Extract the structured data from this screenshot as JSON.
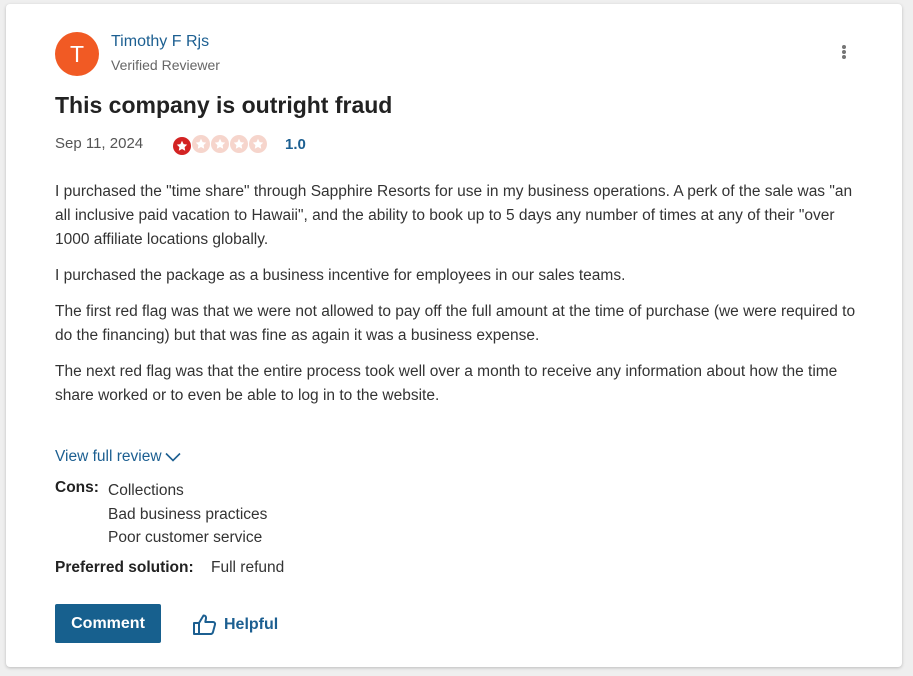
{
  "review": {
    "author": {
      "initial": "T",
      "name": "Timothy F Rjs",
      "status": "Verified Reviewer",
      "avatar_color": "#f15a24"
    },
    "more_icon": "more-vertical-icon",
    "title": "This company is outright fraud",
    "date": "Sep 11, 2024",
    "rating": {
      "value": 1.0,
      "max": 5,
      "label": "1.0",
      "filled_color": "#d32323",
      "empty_color": "#f6d5cc"
    },
    "paragraphs": [
      "I purchased the \"time share\" through Sapphire Resorts for use in my business operations. A perk of the sale was \"an all inclusive paid vacation to Hawaii\", and the ability to book up to 5 days any number of times at any of their \"over 1000 affiliate locations globally.",
      "I purchased the package as a business incentive for employees in our sales teams.",
      "The first red flag was that we were not allowed to pay off the full amount at the time of purchase (we were required to do the financing) but that was fine as again it was a business expense.",
      "The next red flag was that the entire process took well over a month to receive any information about how the time share worked or to even be able to log in to the website."
    ],
    "view_full_label": "View full review",
    "cons_label": "Cons:",
    "cons": [
      "Collections",
      "Bad business practices",
      "Poor customer service"
    ],
    "preferred_solution_label": "Preferred solution:",
    "preferred_solution": "Full refund"
  },
  "actions": {
    "comment_label": "Comment",
    "helpful_label": "Helpful",
    "helpful_icon": "thumbs-up-icon",
    "accent_color": "#17608e"
  }
}
